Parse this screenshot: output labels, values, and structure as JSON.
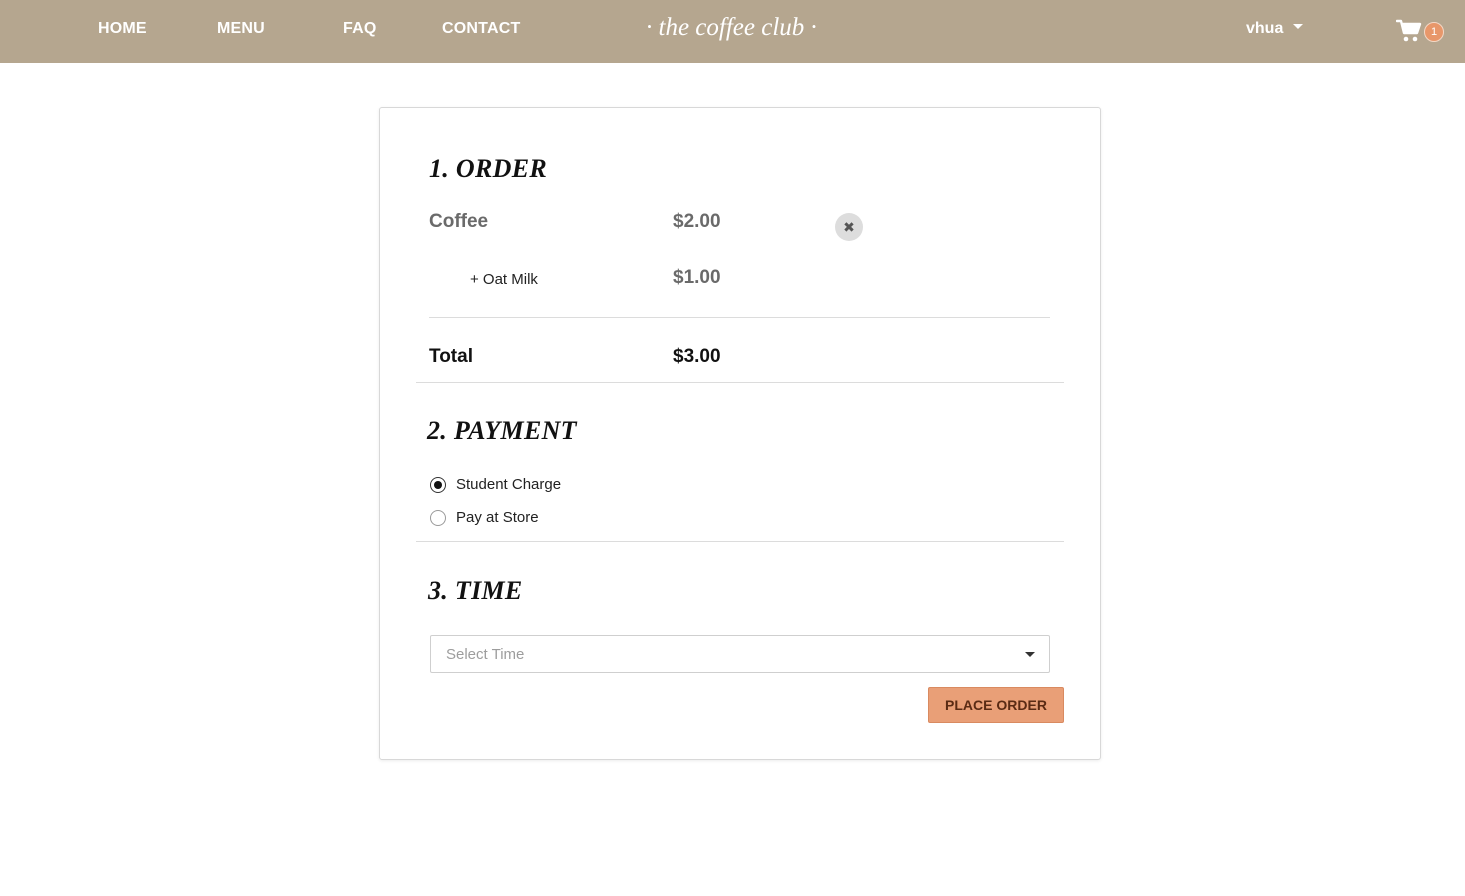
{
  "nav": {
    "links": [
      "HOME",
      "MENU",
      "FAQ",
      "CONTACT"
    ],
    "brand": "· the coffee club ·",
    "user": "vhua",
    "cart_count": "1"
  },
  "order": {
    "title": "1. ORDER",
    "item": {
      "name": "Coffee",
      "price": "$2.00",
      "remove_symbol": "✖"
    },
    "modifier": {
      "name": "+ Oat Milk",
      "price": "$1.00"
    },
    "total_label": "Total",
    "total_value": "$3.00"
  },
  "payment": {
    "title": "2. PAYMENT",
    "options": [
      "Student Charge",
      "Pay at Store"
    ],
    "selected": "Student Charge"
  },
  "time": {
    "title": "3. TIME",
    "placeholder": "Select Time"
  },
  "place_order_label": "PLACE ORDER",
  "colors": {
    "header": "#b5a68f",
    "accent": "#e99f77",
    "badge": "#e8976a"
  }
}
